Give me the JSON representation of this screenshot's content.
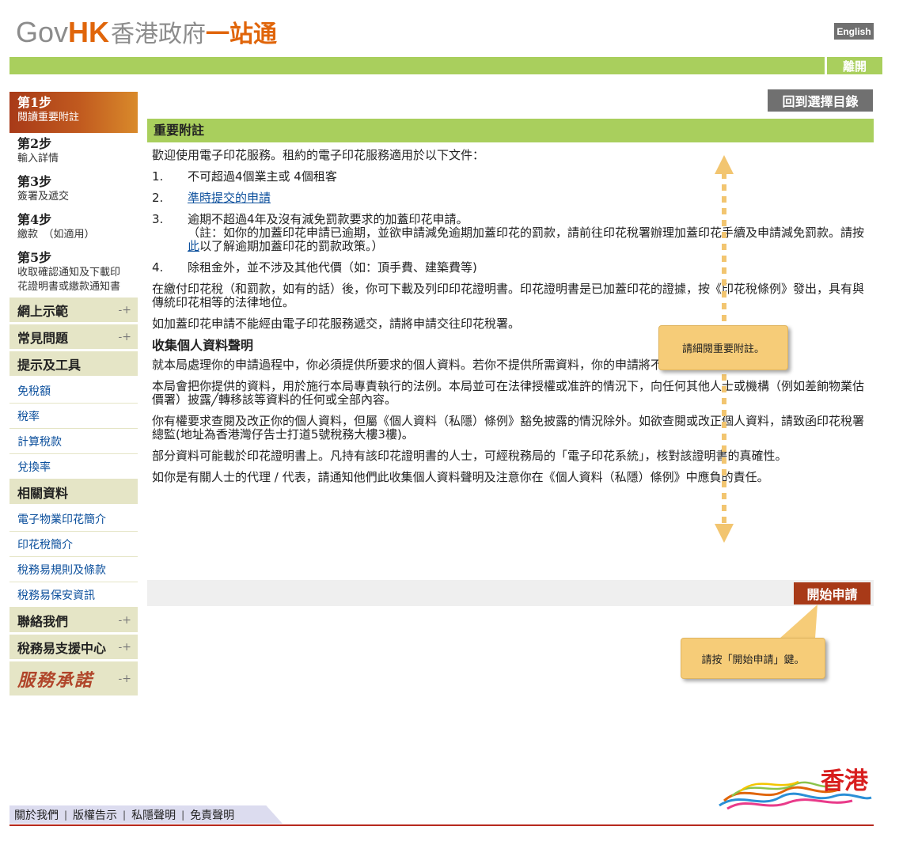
{
  "header": {
    "logo_gov": "Gov",
    "logo_hk": "HK",
    "logo_zh_gray": "香港政府",
    "logo_zh_orange": "一站通",
    "lang_button": "English",
    "exit_button": "離開"
  },
  "sidebar": {
    "steps": [
      {
        "title": "第1步",
        "desc": "閱讀重要附註"
      },
      {
        "title": "第2步",
        "desc": "輸入詳情"
      },
      {
        "title": "第3步",
        "desc": "簽署及遞交"
      },
      {
        "title": "第4步",
        "desc": "繳款　（如適用）"
      },
      {
        "title": "第5步",
        "desc": "收取確認通知及下載印花證明書或繳款通知書"
      }
    ],
    "nav": {
      "demo": "網上示範",
      "faq": "常見問題",
      "tips_head": "提示及工具",
      "allowance": "免稅額",
      "tax_rate": "稅率",
      "calc_tax": "計算稅款",
      "exchange": "兌換率",
      "related_head": "相關資料",
      "e_stamp": "電子物業印花簡介",
      "stamp_duty": "印花稅簡介",
      "terms": "稅務易規則及條款",
      "security": "稅務易保安資訊",
      "contact": "聯絡我們",
      "support": "稅務易支援中心",
      "pledge": "服務承諾"
    }
  },
  "main": {
    "back_button": "回到選擇目錄",
    "section_title": "重要附註",
    "intro": "歡迎使用電子印花服務。租約的電子印花服務適用於以下文件：",
    "list": [
      {
        "num": "1.",
        "text": "不可超過4個業主或 4個租客"
      },
      {
        "num": "2.",
        "link": "準時提交的申請"
      },
      {
        "num": "3.",
        "text": "逾期不超過4年及沒有減免罰款要求的加蓋印花申請。",
        "note_a": "（註：如你的加蓋印花申請已逾期，並欲申請減免逾期加蓋印花的罰款，請前往印花稅署辦理加蓋印花手續及申請減免罰款。請按",
        "note_link": "此",
        "note_b": "以了解逾期加蓋印花的罰款政策。）"
      },
      {
        "num": "4.",
        "text": "除租金外，並不涉及其他代價（如：頂手費、建築費等)"
      }
    ],
    "para1": "在繳付印花稅（和罰款，如有的話）後，你可下載及列印印花證明書。印花證明書是已加蓋印花的證據，按《印花稅條例》發出，具有與傳統印花相等的法律地位。",
    "para2": "如加蓋印花申請不能經由電子印花服務遞交，請將申請交往印花稅署。",
    "privacy_title": "收集個人資料聲明",
    "privacy": [
      "就本局處理你的申請過程中，你必須提供所要求的個人資料。若你不提供所需資料，你的申請將不獲受理。",
      "本局會把你提供的資料，用於施行本局專責執行的法例。本局並可在法律授權或准許的情況下，向任何其他人士或機構（例如差餉物業估價署）披露╱轉移該等資料的任何或全部內容。",
      "你有權要求查閱及改正你的個人資料，但屬《個人資料（私隱）條例》豁免披露的情況除外。如欲查閱或改正個人資料，請致函印花稅署總監(地址為香港灣仔告士打道5號稅務大樓3樓)。",
      "部分資料可能載於印花證明書上。凡持有該印花證明書的人士，可經稅務局的「電子印花系統」，核對該證明書的真確性。",
      "如你是有關人士的代理 / 代表，請通知他們此收集個人資料聲明及注意你在《個人資料（私隱）條例》中應負的責任。"
    ],
    "start_button": "開始申請"
  },
  "tooltips": {
    "read_notes": "請細閱重要附註。",
    "press_start": "請按「開始申請」鍵。"
  },
  "footer": {
    "links": [
      "關於我們",
      "版權告示",
      "私隱聲明",
      "免責聲明"
    ],
    "separator": "|",
    "brand_text": "香港"
  }
}
